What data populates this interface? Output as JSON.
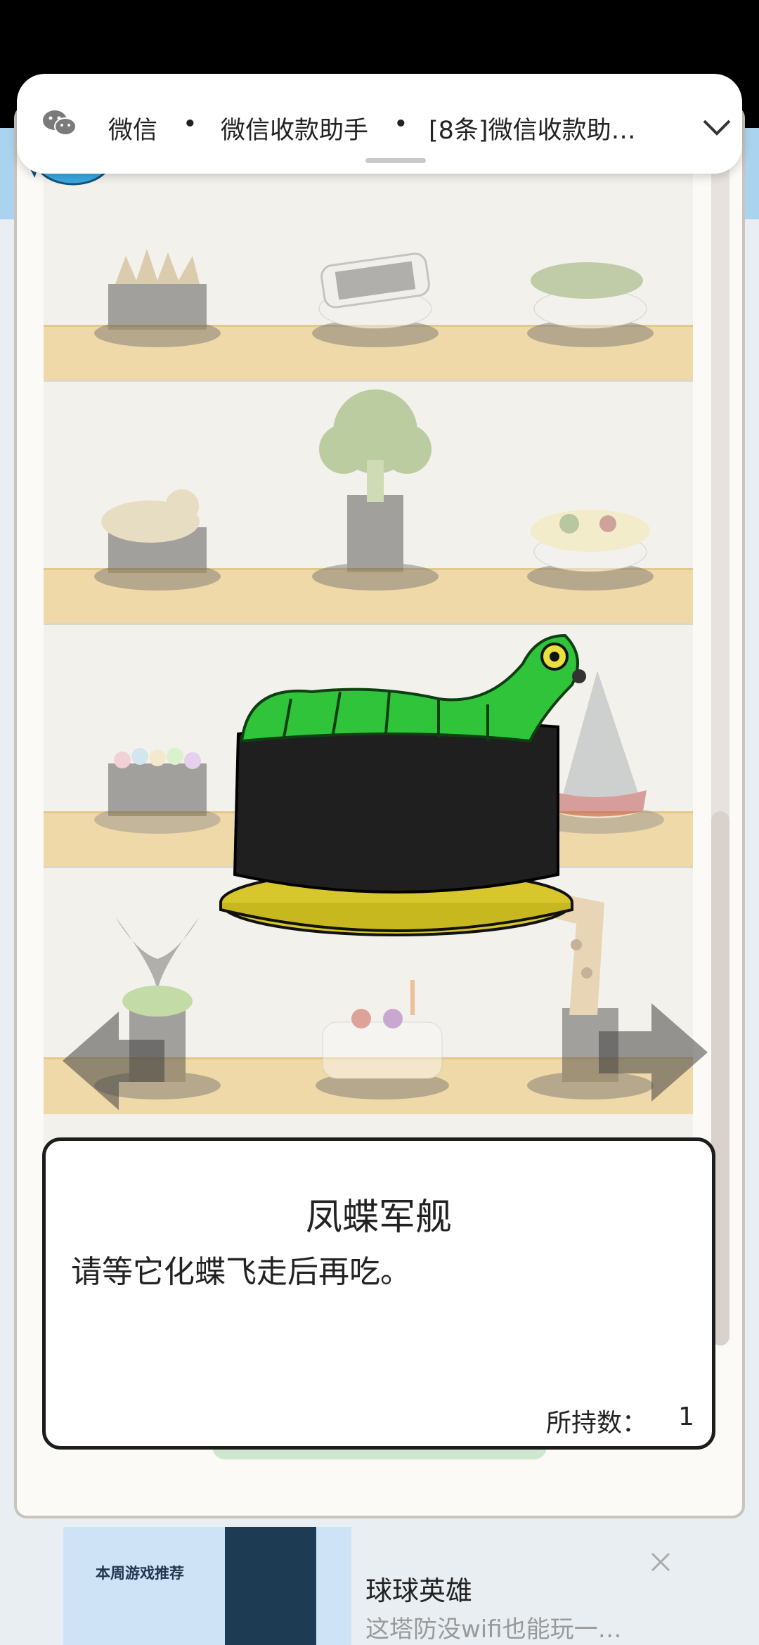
{
  "notification": {
    "app_name": "微信",
    "separator": "•",
    "sender": "微信收款助手",
    "message": "[8条]微信收款助…"
  },
  "sushi_info": {
    "name": "凤蝶军舰",
    "description": "请等它化蝶飞走后再吃。",
    "count_label": "所持数：",
    "count_value": "1"
  },
  "ad": {
    "promo_label": "本周游戏推荐",
    "title": "球球英雄",
    "subtitle": "这塔防没wifi也能玩一…"
  },
  "colors": {
    "plank": "#efd9a8",
    "caterpillar": "#2fc43a",
    "plate_highlight": "#e3d43a",
    "border": "#1d1d1d"
  }
}
